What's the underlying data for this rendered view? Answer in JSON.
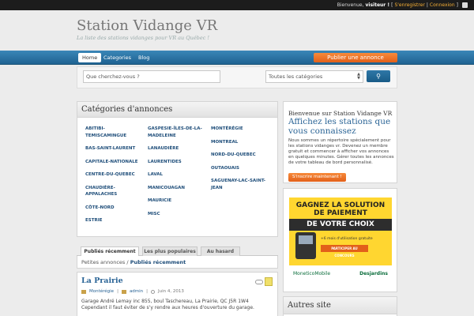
{
  "topbar": {
    "greeting": "Bienvenue,",
    "user": "visiteur !",
    "bracket_open": "[",
    "register": "S'enregistrer",
    "sep": "|",
    "login": "Connexion",
    "bracket_close": "]"
  },
  "site": {
    "title": "Station Vidange VR",
    "tagline": "La liste des stations vidanges pour VR au Québec !"
  },
  "nav": {
    "items": [
      "Home",
      "Categories",
      "Blog"
    ],
    "post_button": "Publier une annonce"
  },
  "search": {
    "placeholder": "Que cherchez-vous ?",
    "category_select": "Toutes les catégories"
  },
  "categories": {
    "title": "Catégories d'annonces",
    "col1": [
      "ABITIBI-TEMISCAMINGUE",
      "BAS-SAINT-LAURENT",
      "CAPITALE-NATIONALE",
      "CENTRE-DU-QUEBEC",
      "CHAUDIÈRE-APPALACHES",
      "CÔTE-NORD",
      "ESTRIE"
    ],
    "col2": [
      "GASPESIE-ÎLES-DE-LA-MADELEINE",
      "LANAUDIÈRE",
      "LAURENTIDES",
      "LAVAL",
      "MANICOUAGAN",
      "MAURICIE",
      "MISC"
    ],
    "col3": [
      "MONTÉRÉGIE",
      "MONTREAL",
      "NORD-DU-QUEBEC",
      "OUTAOUAIS",
      "SAGUENAY-LAC-SAINT-JEAN"
    ]
  },
  "welcome": {
    "heading": "Bienvenue sur Station Vidange VR",
    "subheading": "Affichez les stations que vous connaissez",
    "body": "Nous sommes un répertoire spécialement pour les stations vidanges vr. Devenez un membre gratuit et commencer à afficher vos annonces en quelques minutes. Gérer toutes les annonces de votre tableau de bord personnalisé.",
    "button": "S'inscrire maintenant !"
  },
  "ad": {
    "line1": "GAGNEZ LA SOLUTION",
    "line2": "DE PAIEMENT",
    "band": "DE VOTRE CHOIX",
    "sub": "+6 mois d'utilisation gratuite",
    "cta": "PARTICIPER AU CONCOURS",
    "brand_left": "MoneticoMobile",
    "brand_right": "Desjardins"
  },
  "sidebar": {
    "other_sites": "Autres site"
  },
  "tabs": [
    "Publiés récemment",
    "Les plus populaires",
    "Au hasard"
  ],
  "breadcrumb": {
    "root": "Petites annonces",
    "sep": "/",
    "current": "Publiés récemment"
  },
  "listing": {
    "title": "La Prairie",
    "category": "Montérégie",
    "author": "admin",
    "date": "Juin 4, 2013",
    "description": "Garage André Lemay inc 855, boul Taschereau, La Prairie, QC J5R 1W4 Cependant il faut éviter de s'y rendre aux heures d'ouverture du garage."
  },
  "colors": {
    "nav": "#1f6392",
    "accent": "#e2601a",
    "link": "#2a6496"
  }
}
